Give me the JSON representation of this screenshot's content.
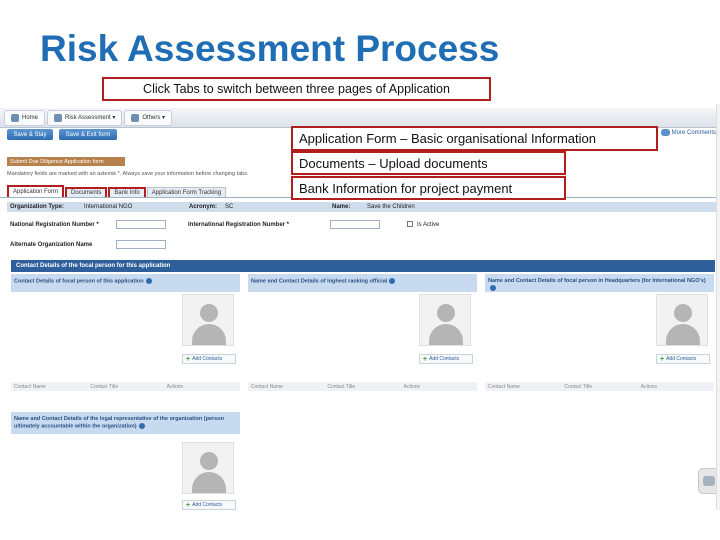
{
  "slide": {
    "title": "Risk Assessment Process"
  },
  "callouts": {
    "top": "Click Tabs to switch between three pages of Application",
    "application_form": "Application Form – Basic organisational Information",
    "documents": "Documents – Upload documents",
    "bank_info": "Bank Information for project payment"
  },
  "nav": {
    "home": "Home",
    "risk_assessment": "Risk Assessment ▾",
    "others": "Others ▾"
  },
  "toolbar": {
    "save_stay": "Save & Stay",
    "save_exit": "Save & Exit form",
    "more_comments": "More Comments"
  },
  "form": {
    "submit_label": "Submit Due Diligence Application form",
    "mandatory_note": "Mandatory fields are marked with an asterisk *. Always save your information before changing tabs.",
    "tabs": [
      "Application Form",
      "Documents",
      "Bank Info",
      "Application Form Tracking"
    ],
    "org_type_label": "Organization Type:",
    "org_type_value": "International NGO",
    "acronym_label": "Acronym:",
    "acronym_value": "SC",
    "name_label": "Name:",
    "name_value": "Save the Children",
    "nat_reg_label": "National Registration Number *",
    "intl_reg_label": "International Registration Number *",
    "is_active_label": "Is Active",
    "alt_org_label": "Alternate Organization Name"
  },
  "contact_section": {
    "title": "Contact Details of the focal person for this application",
    "panels": [
      {
        "title": "Contact Details of focal person of this application",
        "add": "Add Contacts"
      },
      {
        "title": "Name and Contact Details of highest ranking official",
        "add": "Add Contacts"
      },
      {
        "title": "Name and Contact Details of focal person in Headquarters (for International NGO's)",
        "add": "Add Contacts"
      },
      {
        "title": "Name and Contact Details of the legal representative of the organization (person ultimately accountable within the organization)",
        "add": "Add Contacts"
      }
    ],
    "columns": [
      "Contact Name",
      "Contact Title",
      "Actions"
    ]
  }
}
